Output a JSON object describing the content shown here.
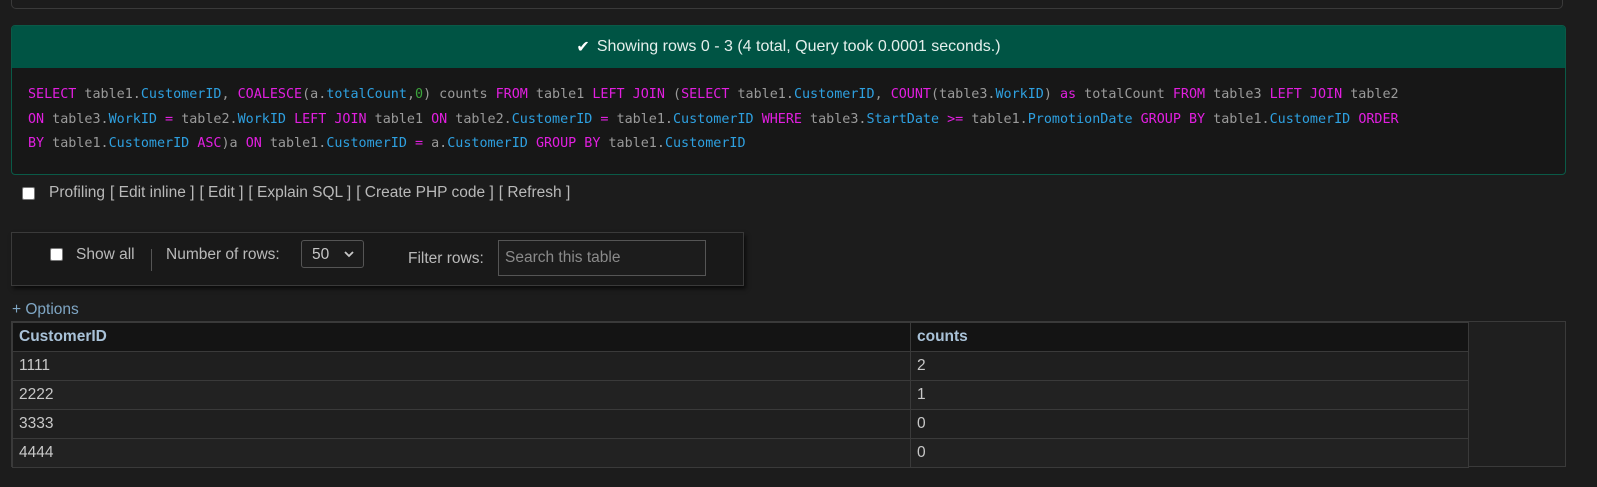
{
  "message": {
    "icon": "check-icon",
    "text": "Showing rows 0 - 3 (4 total, Query took 0.0001 seconds.)"
  },
  "sql": {
    "lines": [
      [
        {
          "t": "SELECT",
          "c": "kw"
        },
        {
          "t": " table1.",
          "c": "pl"
        },
        {
          "t": "CustomerID",
          "c": "fld"
        },
        {
          "t": ", ",
          "c": "pl"
        },
        {
          "t": "COALESCE",
          "c": "fn"
        },
        {
          "t": "(a.",
          "c": "pl"
        },
        {
          "t": "totalCount",
          "c": "fld"
        },
        {
          "t": ",",
          "c": "pl"
        },
        {
          "t": "0",
          "c": "num"
        },
        {
          "t": ") counts ",
          "c": "pl"
        },
        {
          "t": "FROM",
          "c": "kw"
        },
        {
          "t": " table1 ",
          "c": "pl"
        },
        {
          "t": "LEFT JOIN",
          "c": "kw"
        },
        {
          "t": " (",
          "c": "pl"
        },
        {
          "t": "SELECT",
          "c": "kw"
        },
        {
          "t": " table1.",
          "c": "pl"
        },
        {
          "t": "CustomerID",
          "c": "fld"
        },
        {
          "t": ", ",
          "c": "pl"
        },
        {
          "t": "COUNT",
          "c": "fn"
        },
        {
          "t": "(table3.",
          "c": "pl"
        },
        {
          "t": "WorkID",
          "c": "fld"
        },
        {
          "t": ") ",
          "c": "pl"
        },
        {
          "t": "as",
          "c": "kw"
        },
        {
          "t": " totalCount ",
          "c": "pl"
        },
        {
          "t": "FROM",
          "c": "kw"
        },
        {
          "t": " table3 ",
          "c": "pl"
        },
        {
          "t": "LEFT JOIN",
          "c": "kw"
        },
        {
          "t": " table2",
          "c": "pl"
        }
      ],
      [
        {
          "t": "ON",
          "c": "kw"
        },
        {
          "t": " table3.",
          "c": "pl"
        },
        {
          "t": "WorkID",
          "c": "fld"
        },
        {
          "t": " = ",
          "c": "kw"
        },
        {
          "t": "table2.",
          "c": "pl"
        },
        {
          "t": "WorkID",
          "c": "fld"
        },
        {
          "t": " ",
          "c": "pl"
        },
        {
          "t": "LEFT JOIN",
          "c": "kw"
        },
        {
          "t": " table1 ",
          "c": "pl"
        },
        {
          "t": "ON",
          "c": "kw"
        },
        {
          "t": " table2.",
          "c": "pl"
        },
        {
          "t": "CustomerID",
          "c": "fld"
        },
        {
          "t": " = ",
          "c": "kw"
        },
        {
          "t": "table1.",
          "c": "pl"
        },
        {
          "t": "CustomerID",
          "c": "fld"
        },
        {
          "t": " ",
          "c": "pl"
        },
        {
          "t": "WHERE",
          "c": "kw"
        },
        {
          "t": " table3.",
          "c": "pl"
        },
        {
          "t": "StartDate",
          "c": "fld"
        },
        {
          "t": " >= ",
          "c": "kw"
        },
        {
          "t": "table1.",
          "c": "pl"
        },
        {
          "t": "PromotionDate",
          "c": "fld"
        },
        {
          "t": " ",
          "c": "pl"
        },
        {
          "t": "GROUP BY",
          "c": "kw"
        },
        {
          "t": " table1.",
          "c": "pl"
        },
        {
          "t": "CustomerID",
          "c": "fld"
        },
        {
          "t": " ",
          "c": "pl"
        },
        {
          "t": "ORDER",
          "c": "kw"
        }
      ],
      [
        {
          "t": "BY",
          "c": "kw"
        },
        {
          "t": " table1.",
          "c": "pl"
        },
        {
          "t": "CustomerID",
          "c": "fld"
        },
        {
          "t": " ",
          "c": "pl"
        },
        {
          "t": "ASC",
          "c": "kw"
        },
        {
          "t": ")a ",
          "c": "pl"
        },
        {
          "t": "ON",
          "c": "kw"
        },
        {
          "t": " table1.",
          "c": "pl"
        },
        {
          "t": "CustomerID",
          "c": "fld"
        },
        {
          "t": " = ",
          "c": "kw"
        },
        {
          "t": "a.",
          "c": "pl"
        },
        {
          "t": "CustomerID",
          "c": "fld"
        },
        {
          "t": " ",
          "c": "pl"
        },
        {
          "t": "GROUP BY",
          "c": "kw"
        },
        {
          "t": " table1.",
          "c": "pl"
        },
        {
          "t": "CustomerID",
          "c": "fld"
        }
      ]
    ]
  },
  "links": {
    "profiling": "Profiling",
    "edit_inline": "[ Edit inline ]",
    "edit": "[ Edit ]",
    "explain": "[ Explain SQL ]",
    "php": "[ Create PHP code ]",
    "refresh": "[ Refresh ]"
  },
  "nav": {
    "show_all": "Show all",
    "number_of_rows_label": "Number of rows:",
    "number_of_rows_value": "50",
    "filter_label": "Filter rows:",
    "search_placeholder": "Search this table"
  },
  "options_link": "+ Options",
  "table": {
    "columns": [
      "CustomerID",
      "counts"
    ],
    "rows": [
      [
        "1111",
        "2"
      ],
      [
        "2222",
        "1"
      ],
      [
        "3333",
        "0"
      ],
      [
        "4444",
        "0"
      ]
    ]
  }
}
